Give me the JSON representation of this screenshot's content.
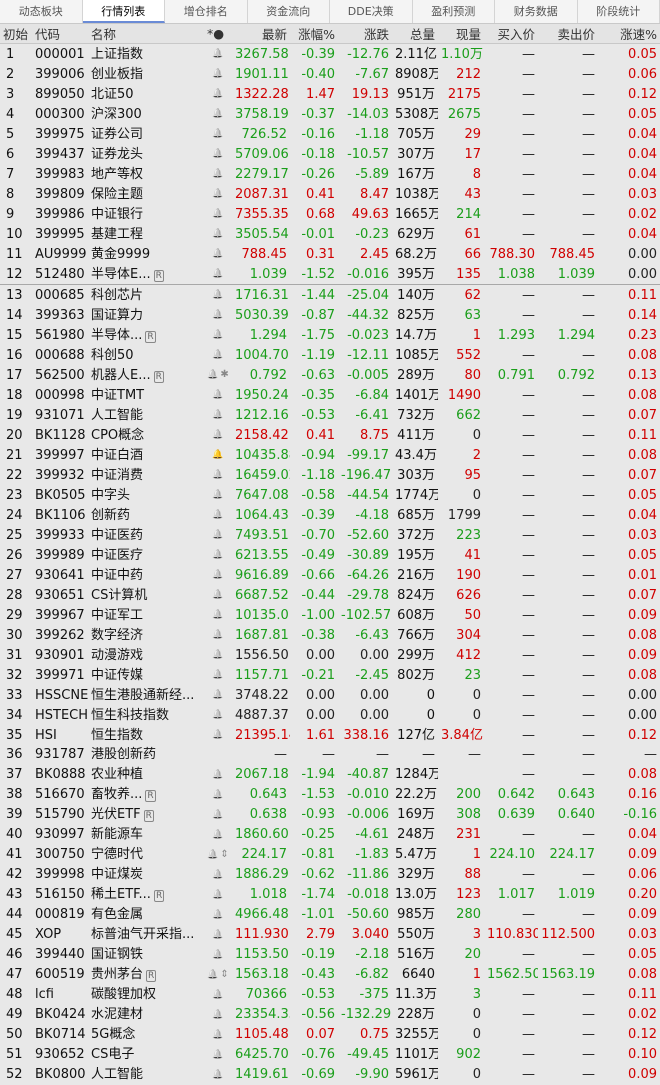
{
  "tabs": [
    {
      "label": "动态板块"
    },
    {
      "label": "行情列表"
    },
    {
      "label": "增仓排名"
    },
    {
      "label": "资金流向"
    },
    {
      "label": "DDE决策"
    },
    {
      "label": "盈利预测"
    },
    {
      "label": "财务数据"
    },
    {
      "label": "阶段统计"
    }
  ],
  "active_tab": 1,
  "columns": {
    "idx": "初始",
    "code": "代码",
    "name": "名称",
    "marks": "*●",
    "last": "最新",
    "pct": "涨幅%",
    "chg": "涨跌",
    "vol": "总量",
    "cur": "现量",
    "bid": "买入价",
    "ask": "卖出价",
    "speed": "涨速%"
  },
  "colors": {
    "up": "#d00000",
    "down": "#1a9e1a",
    "header_bg": "#e4e4e4",
    "tab_active_line": "#6a8bd6"
  },
  "rows": [
    {
      "idx": "1",
      "code": "000001",
      "name": "上证指数",
      "last": "3267.58",
      "pct": "-0.39",
      "chg": "-12.76",
      "vol": "2.11亿",
      "cur": "1.10万",
      "bid": "—",
      "ask": "—",
      "speed": "0.05",
      "dir": "down",
      "cdir": "down",
      "sdir": "up"
    },
    {
      "idx": "2",
      "code": "399006",
      "name": "创业板指",
      "last": "1901.11",
      "pct": "-0.40",
      "chg": "-7.67",
      "vol": "8908万",
      "cur": "212",
      "bid": "—",
      "ask": "—",
      "speed": "0.06",
      "dir": "down",
      "cdir": "up",
      "sdir": "up"
    },
    {
      "idx": "3",
      "code": "899050",
      "name": "北证50",
      "last": "1322.28",
      "pct": "1.47",
      "chg": "19.13",
      "vol": "951万",
      "cur": "2175",
      "bid": "—",
      "ask": "—",
      "speed": "0.12",
      "dir": "up",
      "cdir": "up",
      "sdir": "up"
    },
    {
      "idx": "4",
      "code": "000300",
      "name": "沪深300",
      "last": "3758.19",
      "pct": "-0.37",
      "chg": "-14.03",
      "vol": "5308万",
      "cur": "2675",
      "bid": "—",
      "ask": "—",
      "speed": "0.05",
      "dir": "down",
      "cdir": "down",
      "sdir": "up"
    },
    {
      "idx": "5",
      "code": "399975",
      "name": "证券公司",
      "last": "726.52",
      "pct": "-0.16",
      "chg": "-1.18",
      "vol": "705万",
      "cur": "29",
      "bid": "—",
      "ask": "—",
      "speed": "0.04",
      "dir": "down",
      "cdir": "up",
      "sdir": "up"
    },
    {
      "idx": "6",
      "code": "399437",
      "name": "证券龙头",
      "last": "5709.06",
      "pct": "-0.18",
      "chg": "-10.57",
      "vol": "307万",
      "cur": "17",
      "bid": "—",
      "ask": "—",
      "speed": "0.04",
      "dir": "down",
      "cdir": "up",
      "sdir": "up"
    },
    {
      "idx": "7",
      "code": "399983",
      "name": "地产等权",
      "last": "2279.17",
      "pct": "-0.26",
      "chg": "-5.89",
      "vol": "167万",
      "cur": "8",
      "bid": "—",
      "ask": "—",
      "speed": "0.04",
      "dir": "down",
      "cdir": "up",
      "sdir": "up"
    },
    {
      "idx": "8",
      "code": "399809",
      "name": "保险主题",
      "last": "2087.31",
      "pct": "0.41",
      "chg": "8.47",
      "vol": "1038万",
      "cur": "43",
      "bid": "—",
      "ask": "—",
      "speed": "0.03",
      "dir": "up",
      "cdir": "up",
      "sdir": "up"
    },
    {
      "idx": "9",
      "code": "399986",
      "name": "中证银行",
      "last": "7355.35",
      "pct": "0.68",
      "chg": "49.63",
      "vol": "1665万",
      "cur": "214",
      "bid": "—",
      "ask": "—",
      "speed": "0.02",
      "dir": "up",
      "cdir": "down",
      "sdir": "up"
    },
    {
      "idx": "10",
      "code": "399995",
      "name": "基建工程",
      "last": "3505.54",
      "pct": "-0.01",
      "chg": "-0.23",
      "vol": "629万",
      "cur": "61",
      "bid": "—",
      "ask": "—",
      "speed": "0.04",
      "dir": "down",
      "cdir": "up",
      "sdir": "up"
    },
    {
      "idx": "11",
      "code": "AU9999",
      "name": "黄金9999",
      "last": "788.45",
      "pct": "0.31",
      "chg": "2.45",
      "vol": "68.2万",
      "cur": "66",
      "bid": "788.30",
      "ask": "788.45",
      "speed": "0.00",
      "dir": "up",
      "cdir": "up",
      "sdir": "flat",
      "bdir": "up"
    },
    {
      "idx": "12",
      "code": "512480",
      "name": "半导体E...",
      "badge": "R",
      "last": "1.039",
      "pct": "-1.52",
      "chg": "-0.016",
      "vol": "395万",
      "cur": "135",
      "bid": "1.038",
      "ask": "1.039",
      "speed": "0.00",
      "dir": "down",
      "cdir": "up",
      "sdir": "flat",
      "bdir": "down",
      "sep": true
    },
    {
      "idx": "13",
      "code": "000685",
      "name": "科创芯片",
      "last": "1716.31",
      "pct": "-1.44",
      "chg": "-25.04",
      "vol": "140万",
      "cur": "62",
      "bid": "—",
      "ask": "—",
      "speed": "0.11",
      "dir": "down",
      "cdir": "up",
      "sdir": "up"
    },
    {
      "idx": "14",
      "code": "399363",
      "name": "国证算力",
      "last": "5030.39",
      "pct": "-0.87",
      "chg": "-44.32",
      "vol": "825万",
      "cur": "63",
      "bid": "—",
      "ask": "—",
      "speed": "0.14",
      "dir": "down",
      "cdir": "down",
      "sdir": "up"
    },
    {
      "idx": "15",
      "code": "561980",
      "name": "半导体...",
      "badge": "R",
      "last": "1.294",
      "pct": "-1.75",
      "chg": "-0.023",
      "vol": "14.7万",
      "cur": "1",
      "bid": "1.293",
      "ask": "1.294",
      "speed": "0.23",
      "dir": "down",
      "cdir": "up",
      "sdir": "up",
      "bdir": "down"
    },
    {
      "idx": "16",
      "code": "000688",
      "name": "科创50",
      "last": "1004.70",
      "pct": "-1.19",
      "chg": "-12.11",
      "vol": "1085万",
      "cur": "552",
      "bid": "—",
      "ask": "—",
      "speed": "0.08",
      "dir": "down",
      "cdir": "up",
      "sdir": "up"
    },
    {
      "idx": "17",
      "code": "562500",
      "name": "机器人E...",
      "badge": "R",
      "star": "✱",
      "last": "0.792",
      "pct": "-0.63",
      "chg": "-0.005",
      "vol": "289万",
      "cur": "80",
      "bid": "0.791",
      "ask": "0.792",
      "speed": "0.13",
      "dir": "down",
      "cdir": "up",
      "sdir": "up",
      "bdir": "down"
    },
    {
      "idx": "18",
      "code": "000998",
      "name": "中证TMT",
      "last": "1950.24",
      "pct": "-0.35",
      "chg": "-6.84",
      "vol": "1401万",
      "cur": "1490",
      "bid": "—",
      "ask": "—",
      "speed": "0.08",
      "dir": "down",
      "cdir": "up",
      "sdir": "up"
    },
    {
      "idx": "19",
      "code": "931071",
      "name": "人工智能",
      "last": "1212.16",
      "pct": "-0.53",
      "chg": "-6.41",
      "vol": "732万",
      "cur": "662",
      "bid": "—",
      "ask": "—",
      "speed": "0.07",
      "dir": "down",
      "cdir": "down",
      "sdir": "up"
    },
    {
      "idx": "20",
      "code": "BK1128",
      "name": "CPO概念",
      "last": "2158.42",
      "pct": "0.41",
      "chg": "8.75",
      "vol": "411万",
      "cur": "0",
      "bid": "—",
      "ask": "—",
      "speed": "0.11",
      "dir": "up",
      "cdir": "flat",
      "sdir": "up"
    },
    {
      "idx": "21",
      "code": "399997",
      "name": "中证白酒",
      "hot": true,
      "last": "10435.88",
      "pct": "-0.94",
      "chg": "-99.17",
      "vol": "43.4万",
      "cur": "2",
      "bid": "—",
      "ask": "—",
      "speed": "0.08",
      "dir": "down",
      "cdir": "up",
      "sdir": "up"
    },
    {
      "idx": "22",
      "code": "399932",
      "name": "中证消费",
      "last": "16459.02",
      "pct": "-1.18",
      "chg": "-196.47",
      "vol": "303万",
      "cur": "95",
      "bid": "—",
      "ask": "—",
      "speed": "0.07",
      "dir": "down",
      "cdir": "up",
      "sdir": "up"
    },
    {
      "idx": "23",
      "code": "BK0505",
      "name": "中字头",
      "last": "7647.08",
      "pct": "-0.58",
      "chg": "-44.54",
      "vol": "1774万",
      "cur": "0",
      "bid": "—",
      "ask": "—",
      "speed": "0.05",
      "dir": "down",
      "cdir": "flat",
      "sdir": "up"
    },
    {
      "idx": "24",
      "code": "BK1106",
      "name": "创新药",
      "last": "1064.43",
      "pct": "-0.39",
      "chg": "-4.18",
      "vol": "685万",
      "cur": "1799",
      "bid": "—",
      "ask": "—",
      "speed": "0.04",
      "dir": "down",
      "cdir": "flat",
      "sdir": "up"
    },
    {
      "idx": "25",
      "code": "399933",
      "name": "中证医药",
      "last": "7493.51",
      "pct": "-0.70",
      "chg": "-52.60",
      "vol": "372万",
      "cur": "223",
      "bid": "—",
      "ask": "—",
      "speed": "0.03",
      "dir": "down",
      "cdir": "down",
      "sdir": "up"
    },
    {
      "idx": "26",
      "code": "399989",
      "name": "中证医疗",
      "last": "6213.55",
      "pct": "-0.49",
      "chg": "-30.89",
      "vol": "195万",
      "cur": "41",
      "bid": "—",
      "ask": "—",
      "speed": "0.05",
      "dir": "down",
      "cdir": "up",
      "sdir": "up"
    },
    {
      "idx": "27",
      "code": "930641",
      "name": "中证中药",
      "last": "9616.89",
      "pct": "-0.66",
      "chg": "-64.26",
      "vol": "216万",
      "cur": "190",
      "bid": "—",
      "ask": "—",
      "speed": "0.01",
      "dir": "down",
      "cdir": "up",
      "sdir": "up"
    },
    {
      "idx": "28",
      "code": "930651",
      "name": "CS计算机",
      "last": "6687.52",
      "pct": "-0.44",
      "chg": "-29.78",
      "vol": "824万",
      "cur": "626",
      "bid": "—",
      "ask": "—",
      "speed": "0.07",
      "dir": "down",
      "cdir": "up",
      "sdir": "up"
    },
    {
      "idx": "29",
      "code": "399967",
      "name": "中证军工",
      "last": "10135.01",
      "pct": "-1.00",
      "chg": "-102.57",
      "vol": "608万",
      "cur": "50",
      "bid": "—",
      "ask": "—",
      "speed": "0.09",
      "dir": "down",
      "cdir": "up",
      "sdir": "up"
    },
    {
      "idx": "30",
      "code": "399262",
      "name": "数字经济",
      "last": "1687.81",
      "pct": "-0.38",
      "chg": "-6.43",
      "vol": "766万",
      "cur": "304",
      "bid": "—",
      "ask": "—",
      "speed": "0.08",
      "dir": "down",
      "cdir": "up",
      "sdir": "up"
    },
    {
      "idx": "31",
      "code": "930901",
      "name": "动漫游戏",
      "last": "1556.50",
      "pct": "0.00",
      "chg": "0.00",
      "vol": "299万",
      "cur": "412",
      "bid": "—",
      "ask": "—",
      "speed": "0.09",
      "dir": "flat",
      "cdir": "up",
      "sdir": "up"
    },
    {
      "idx": "32",
      "code": "399971",
      "name": "中证传媒",
      "last": "1157.71",
      "pct": "-0.21",
      "chg": "-2.45",
      "vol": "802万",
      "cur": "23",
      "bid": "—",
      "ask": "—",
      "speed": "0.08",
      "dir": "down",
      "cdir": "down",
      "sdir": "up"
    },
    {
      "idx": "33",
      "code": "HSSCNE",
      "name": "恒生港股通新经...",
      "last": "3748.22",
      "pct": "0.00",
      "chg": "0.00",
      "vol": "0",
      "cur": "0",
      "bid": "—",
      "ask": "—",
      "speed": "0.00",
      "dir": "flat",
      "cdir": "flat",
      "sdir": "flat"
    },
    {
      "idx": "34",
      "code": "HSTECH",
      "name": "恒生科技指数",
      "last": "4887.37",
      "pct": "0.00",
      "chg": "0.00",
      "vol": "0",
      "cur": "0",
      "bid": "—",
      "ask": "—",
      "speed": "0.00",
      "dir": "flat",
      "cdir": "flat",
      "sdir": "flat"
    },
    {
      "idx": "35",
      "code": "HSI",
      "name": "恒生指数",
      "last": "21395.14",
      "pct": "1.61",
      "chg": "338.16",
      "vol": "127亿",
      "cur": "3.84亿",
      "bid": "—",
      "ask": "—",
      "speed": "0.12",
      "dir": "up",
      "cdir": "up",
      "sdir": "up"
    },
    {
      "idx": "36",
      "code": "931787",
      "name": "港股创新药",
      "nobell": true,
      "last": "—",
      "pct": "—",
      "chg": "—",
      "vol": "—",
      "cur": "—",
      "bid": "—",
      "ask": "—",
      "speed": "—",
      "dir": "flat",
      "cdir": "flat",
      "sdir": "flat"
    },
    {
      "idx": "37",
      "code": "BK0888",
      "name": "农业种植",
      "last": "2067.18",
      "pct": "-1.94",
      "chg": "-40.87",
      "vol": "1284万",
      "cur": "",
      "bid": "—",
      "ask": "—",
      "speed": "0.08",
      "dir": "down",
      "cdir": "flat",
      "sdir": "up"
    },
    {
      "idx": "38",
      "code": "516670",
      "name": "畜牧养...",
      "badge": "R",
      "last": "0.643",
      "pct": "-1.53",
      "chg": "-0.010",
      "vol": "22.2万",
      "cur": "200",
      "bid": "0.642",
      "ask": "0.643",
      "speed": "0.16",
      "dir": "down",
      "cdir": "down",
      "sdir": "up",
      "bdir": "down"
    },
    {
      "idx": "39",
      "code": "515790",
      "name": "光伏ETF",
      "badge": "R",
      "last": "0.638",
      "pct": "-0.93",
      "chg": "-0.006",
      "vol": "169万",
      "cur": "308",
      "bid": "0.639",
      "ask": "0.640",
      "speed": "-0.16",
      "dir": "down",
      "cdir": "down",
      "sdir": "down",
      "bdir": "down"
    },
    {
      "idx": "40",
      "code": "930997",
      "name": "新能源车",
      "last": "1860.60",
      "pct": "-0.25",
      "chg": "-4.61",
      "vol": "248万",
      "cur": "231",
      "bid": "—",
      "ask": "—",
      "speed": "0.04",
      "dir": "down",
      "cdir": "up",
      "sdir": "up"
    },
    {
      "idx": "41",
      "code": "300750",
      "name": "宁德时代",
      "arrow": "⇕",
      "last": "224.17",
      "pct": "-0.81",
      "chg": "-1.83",
      "vol": "5.47万",
      "cur": "1",
      "bid": "224.10",
      "ask": "224.17",
      "speed": "0.09",
      "dir": "down",
      "cdir": "up",
      "sdir": "up",
      "bdir": "down"
    },
    {
      "idx": "42",
      "code": "399998",
      "name": "中证煤炭",
      "last": "1886.29",
      "pct": "-0.62",
      "chg": "-11.86",
      "vol": "329万",
      "cur": "88",
      "bid": "—",
      "ask": "—",
      "speed": "0.06",
      "dir": "down",
      "cdir": "up",
      "sdir": "up"
    },
    {
      "idx": "43",
      "code": "516150",
      "name": "稀土ETF...",
      "badge": "R",
      "last": "1.018",
      "pct": "-1.74",
      "chg": "-0.018",
      "vol": "13.0万",
      "cur": "123",
      "bid": "1.017",
      "ask": "1.019",
      "speed": "0.20",
      "dir": "down",
      "cdir": "up",
      "sdir": "up",
      "bdir": "down"
    },
    {
      "idx": "44",
      "code": "000819",
      "name": "有色金属",
      "last": "4966.48",
      "pct": "-1.01",
      "chg": "-50.60",
      "vol": "985万",
      "cur": "280",
      "bid": "—",
      "ask": "—",
      "speed": "0.09",
      "dir": "down",
      "cdir": "down",
      "sdir": "up"
    },
    {
      "idx": "45",
      "code": "XOP",
      "name": "标普油气开采指...",
      "last": "111.930",
      "pct": "2.79",
      "chg": "3.040",
      "vol": "550万",
      "cur": "3",
      "bid": "110.830",
      "ask": "112.500",
      "speed": "0.03",
      "dir": "up",
      "cdir": "up",
      "sdir": "up",
      "bdir": "up"
    },
    {
      "idx": "46",
      "code": "399440",
      "name": "国证钢铁",
      "last": "1153.50",
      "pct": "-0.19",
      "chg": "-2.18",
      "vol": "516万",
      "cur": "20",
      "bid": "—",
      "ask": "—",
      "speed": "0.05",
      "dir": "down",
      "cdir": "down",
      "sdir": "up"
    },
    {
      "idx": "47",
      "code": "600519",
      "name": "贵州茅台",
      "badge": "R",
      "arrow": "⇕",
      "last": "1563.18",
      "pct": "-0.43",
      "chg": "-6.82",
      "vol": "6640",
      "cur": "1",
      "bid": "1562.50",
      "ask": "1563.19",
      "speed": "0.08",
      "dir": "down",
      "cdir": "up",
      "sdir": "up",
      "bdir": "down"
    },
    {
      "idx": "48",
      "code": "lcfi",
      "name": "碳酸锂加权",
      "last": "70366",
      "pct": "-0.53",
      "chg": "-375",
      "vol": "11.3万",
      "cur": "3",
      "bid": "—",
      "ask": "—",
      "speed": "0.11",
      "dir": "down",
      "cdir": "down",
      "sdir": "up"
    },
    {
      "idx": "49",
      "code": "BK0424",
      "name": "水泥建材",
      "last": "23354.35",
      "pct": "-0.56",
      "chg": "-132.29",
      "vol": "228万",
      "cur": "0",
      "bid": "—",
      "ask": "—",
      "speed": "0.02",
      "dir": "down",
      "cdir": "flat",
      "sdir": "up"
    },
    {
      "idx": "50",
      "code": "BK0714",
      "name": "5G概念",
      "last": "1105.48",
      "pct": "0.07",
      "chg": "0.75",
      "vol": "3255万",
      "cur": "0",
      "bid": "—",
      "ask": "—",
      "speed": "0.12",
      "dir": "up",
      "cdir": "flat",
      "sdir": "up"
    },
    {
      "idx": "51",
      "code": "930652",
      "name": "CS电子",
      "last": "6425.70",
      "pct": "-0.76",
      "chg": "-49.45",
      "vol": "1101万",
      "cur": "902",
      "bid": "—",
      "ask": "—",
      "speed": "0.10",
      "dir": "down",
      "cdir": "down",
      "sdir": "up"
    },
    {
      "idx": "52",
      "code": "BK0800",
      "name": "人工智能",
      "last": "1419.61",
      "pct": "-0.69",
      "chg": "-9.90",
      "vol": "5961万",
      "cur": "0",
      "bid": "—",
      "ask": "—",
      "speed": "0.09",
      "dir": "down",
      "cdir": "flat",
      "sdir": "up"
    }
  ]
}
